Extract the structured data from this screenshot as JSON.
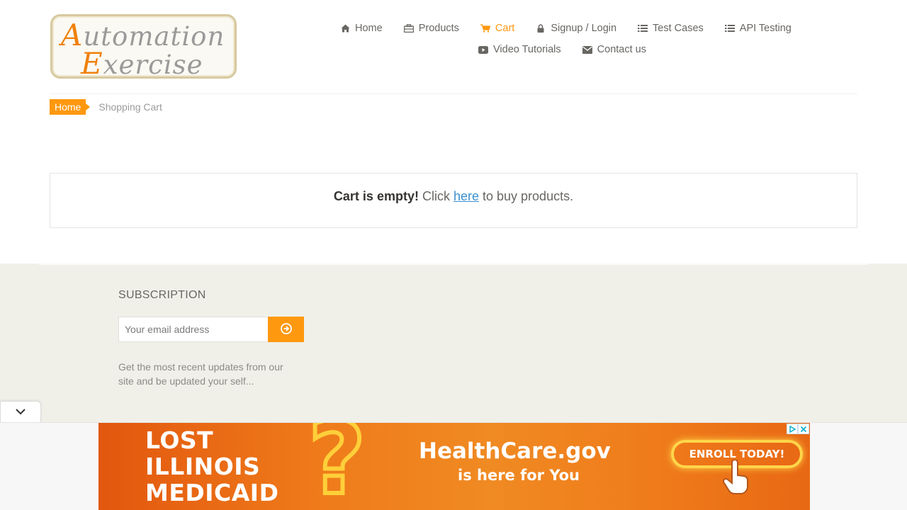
{
  "brand": {
    "logo_line1_cap": "A",
    "logo_line1_rest": "utomation",
    "logo_line2_cap": "E",
    "logo_line2_rest": "xercise"
  },
  "nav": {
    "items": [
      {
        "label": "Home",
        "icon": "home-icon"
      },
      {
        "label": "Products",
        "icon": "briefcase-icon"
      },
      {
        "label": "Cart",
        "icon": "shopping-cart-icon",
        "active": true
      },
      {
        "label": "Signup / Login",
        "icon": "lock-icon"
      },
      {
        "label": "Test Cases",
        "icon": "list-icon"
      },
      {
        "label": "API Testing",
        "icon": "list-icon"
      },
      {
        "label": "Video Tutorials",
        "icon": "youtube-play-icon"
      },
      {
        "label": "Contact us",
        "icon": "envelope-icon"
      }
    ]
  },
  "breadcrumb": {
    "home": "Home",
    "current": "Shopping Cart"
  },
  "cart": {
    "empty_bold": "Cart is empty!",
    "empty_pre": " Click ",
    "empty_link": "here",
    "empty_post": " to buy products."
  },
  "footer": {
    "subscription_title": "SUBSCRIPTION",
    "email_placeholder": "Your email address",
    "description": "Get the most recent updates from our site and be updated your self..."
  },
  "ad": {
    "line1": "LOST",
    "line2": "ILLINOIS",
    "line3": "MEDICAID",
    "brand": "HealthCare.gov",
    "tagline": "is here for You",
    "cta": "ENROLL TODAY!"
  },
  "colors": {
    "accent": "#fe980f",
    "footer_bg": "#f0f0e9",
    "link": "#3b8fcf"
  }
}
